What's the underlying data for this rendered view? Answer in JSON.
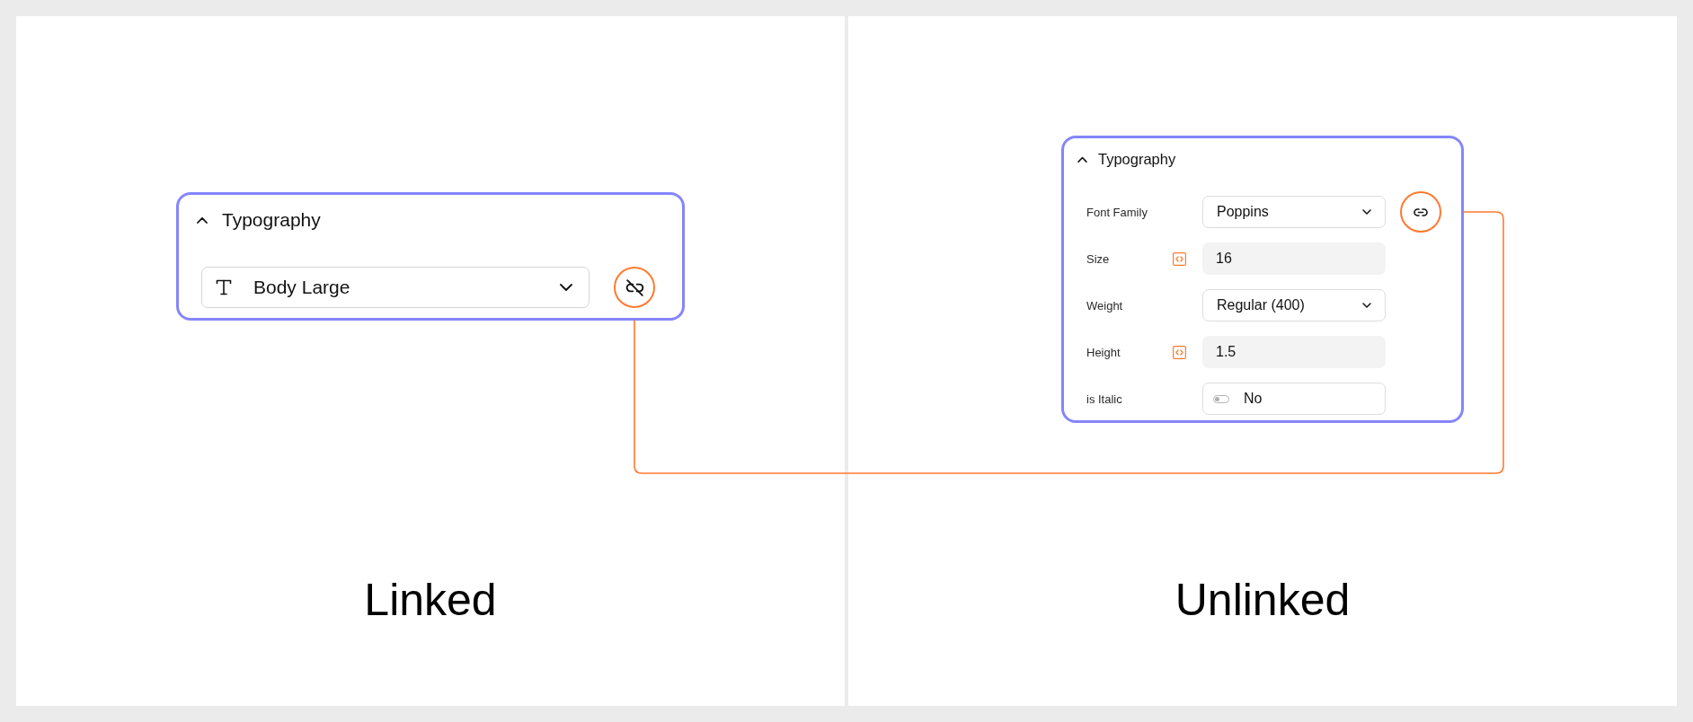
{
  "panels": [
    {
      "kind": "linked",
      "section": {
        "title": "Typography",
        "expanded": true,
        "style_select": {
          "value": "Body Large"
        }
      },
      "caption": "Linked"
    },
    {
      "kind": "unlinked",
      "section": {
        "title": "Typography",
        "expanded": true,
        "fields": [
          {
            "label": "Font Family",
            "kind": "select",
            "value": "Poppins",
            "variable": false
          },
          {
            "label": "Size",
            "kind": "input",
            "value": "16",
            "variable": true
          },
          {
            "label": "Weight",
            "kind": "select",
            "value": "Regular (400)",
            "variable": false
          },
          {
            "label": "Height",
            "kind": "input",
            "value": "1.5",
            "variable": true
          },
          {
            "label": "is Italic",
            "kind": "toggle",
            "value": "No",
            "on": false,
            "variable": false
          }
        ]
      },
      "caption": "Unlinked"
    }
  ]
}
